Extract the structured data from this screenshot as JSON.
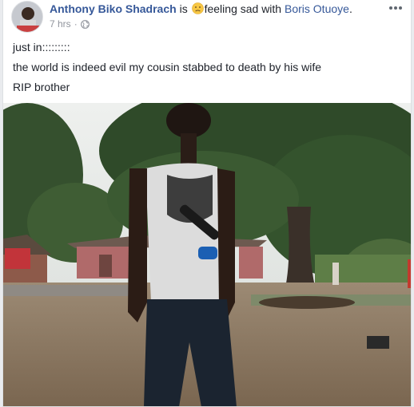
{
  "post": {
    "author": "Anthony Biko Shadrach",
    "is_text": "is",
    "emoji_name": "sad-face-emoji",
    "feeling_text": "feeling sad with",
    "tagged": "Boris Otuoye",
    "punct": ".",
    "time": "7 hrs",
    "separator": "·",
    "privacy_icon": "globe-icon",
    "lines": [
      "just in:::::::::",
      "the world is indeed evil my cousin stabbed to death by his wife",
      "RIP brother"
    ]
  },
  "colors": {
    "link": "#365899",
    "text": "#1d2129",
    "meta": "#90949c"
  }
}
